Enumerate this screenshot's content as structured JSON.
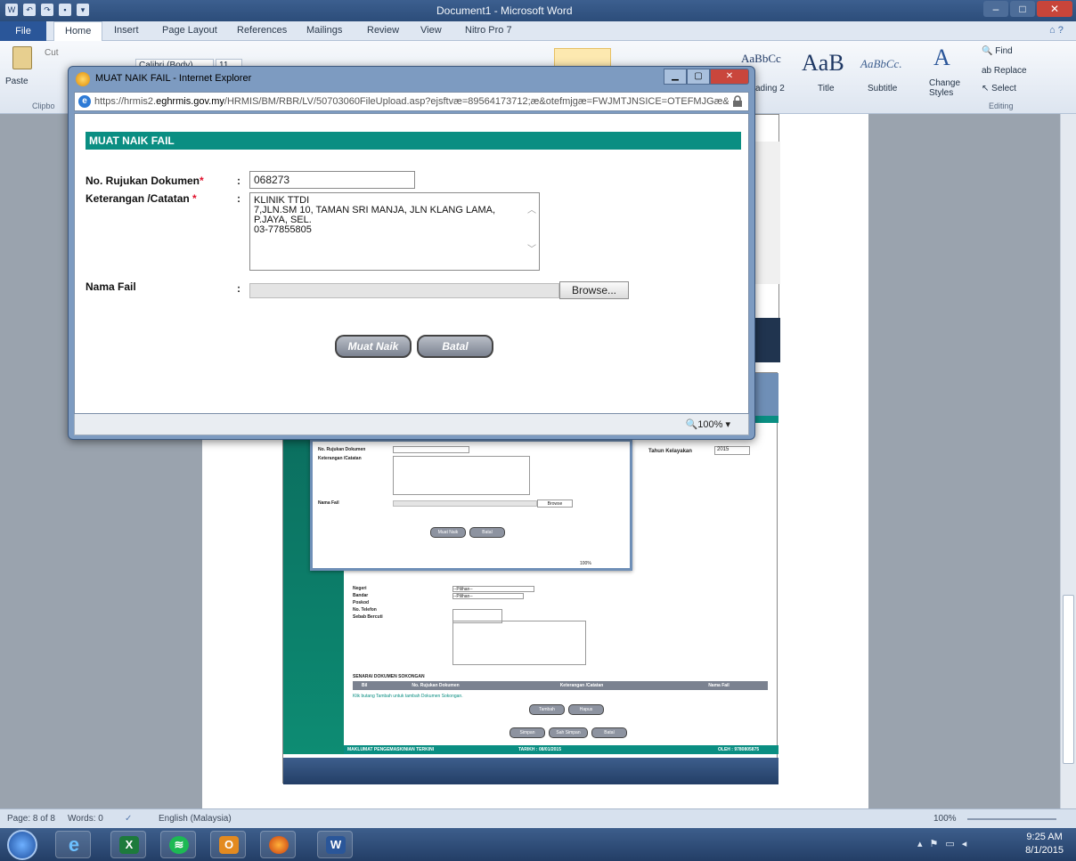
{
  "word": {
    "title": "Document1 - Microsoft Word",
    "tabs": [
      "File",
      "Home",
      "Insert",
      "Page Layout",
      "References",
      "Mailings",
      "Review",
      "View",
      "Nitro Pro 7"
    ],
    "clipboard": {
      "paste": "Paste",
      "cut": "Cut",
      "group": "Clipbo"
    },
    "font": {
      "name": "Calibri (Body)",
      "size": "11"
    },
    "styles": {
      "heading": "ading 2",
      "title": "Title",
      "subtitle": "Subtitle",
      "change_styles": "Change Styles",
      "aabbcc1": "AaBbCc",
      "aab": "AaB",
      "aabbcc2": "AaBbCc."
    },
    "editing": {
      "find": "Find",
      "replace": "Replace",
      "select": "Select",
      "group": "Editing"
    },
    "status": {
      "page": "Page: 8 of 8",
      "words": "Words: 0",
      "language": "English (Malaysia)",
      "zoom": "100%"
    }
  },
  "taskbar": {
    "time": "9:25 AM",
    "date": "8/1/2015"
  },
  "ie": {
    "window_title": "MUAT NAIK FAIL - Internet Explorer",
    "url_prefix": "https://hrmis2.",
    "url_host": "eghrmis.gov.my",
    "url_rest": "/HRMIS/BM/RBR/LV/50703060FileUpload.asp?ejsftvæ=89564173712;æ&otefmjgæ=FWJMTJNSICE=OTEFMJGæ&",
    "zoom": "100%"
  },
  "form": {
    "header": "MUAT NAIK FAIL",
    "ref_label": "No. Rujukan Dokumen",
    "ref_value": "068273",
    "notes_label": "Keterangan /Catatan",
    "notes_value": "KLINIK TTDI\n7,JLN.SM 10, TAMAN SRI MANJA, JLN KLANG LAMA,\nP.JAYA, SEL.\n03-77855805",
    "file_label": "Nama Fail",
    "browse": "Browse...",
    "upload_btn": "Muat Naik",
    "cancel_btn": "Batal",
    "asterisk": "*",
    "colon": ":"
  },
  "embedded": {
    "ref_label": "No. Rujukan Dokumen",
    "notes_label": "Keterangan /Catatan",
    "file_label": "Nama Fail",
    "browse": "Browse",
    "upload": "Muat Naik",
    "cancel": "Batal",
    "year_label": "Tahun Kelayakan",
    "year_value": "2015",
    "negeri": "Negeri",
    "bandar": "Bandar",
    "poskod": "Poskod",
    "telefon": "No. Telefon",
    "alamat": "Sebab Bercuti",
    "pilih": "--Pilihan--",
    "senarai": "SENARAI DOKUMEN SOKONGAN",
    "col_bil": "Bil",
    "col_ref": "No. Rujukan Dokumen",
    "col_notes": "Keterangan /Catatan",
    "col_file": "Nama Fail",
    "hint": "Klik butang Tambah untuk tambah Dokumen Sokongan.",
    "tambah": "Tambah",
    "hapus": "Hapus",
    "simpan": "Simpan",
    "sah": "Sah Simpan",
    "batal": "Batal",
    "footer_left": "MAKLUMAT PENGEMASKINIAN TERKINI",
    "footer_mid": "TARIKH : 08/01/2015",
    "footer_right": "OLEH : 9780805875",
    "zoom": "100%"
  },
  "colors": {
    "teal": "#0a8e82",
    "word_blue": "#2a5699"
  }
}
